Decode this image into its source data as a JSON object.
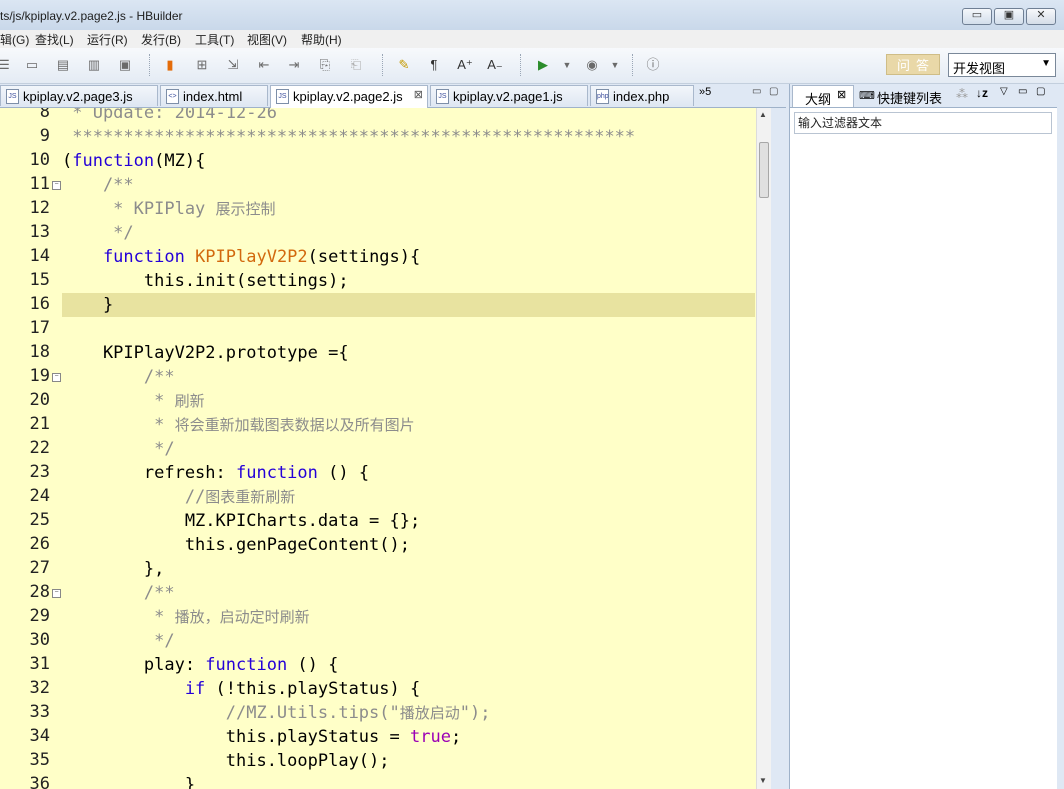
{
  "window": {
    "title": "ts/js/kpiplay.v2.page2.js  -  HBuilder",
    "buttons": {
      "minimize": "▭",
      "maximize": "▣",
      "close": "✕"
    }
  },
  "menu": [
    {
      "label": "辑(G)"
    },
    {
      "label": "查找(L)"
    },
    {
      "label": "运行(R)"
    },
    {
      "label": "发行(B)"
    },
    {
      "label": "工具(T)"
    },
    {
      "label": "视图(V)"
    },
    {
      "label": "帮助(H)"
    }
  ],
  "toolbar": {
    "qa_label": "问答",
    "view_select": "开发视图",
    "icons": [
      "list-icon",
      "layout-icon",
      "layout2-icon",
      "layout3-icon",
      "save-icon",
      "bookmark-icon",
      "new-file-icon",
      "export-icon",
      "prev-icon",
      "next-icon",
      "back-icon",
      "forward-icon",
      "highlighter-icon",
      "pilcrow-icon",
      "font-increase-icon",
      "font-decrease-icon",
      "run-icon",
      "dropdown-icon",
      "browser-icon",
      "dropdown2-icon",
      "info-icon"
    ]
  },
  "tabs": [
    {
      "label": "kpiplay.v2.page3.js",
      "active": false
    },
    {
      "label": "index.html",
      "active": false
    },
    {
      "label": "kpiplay.v2.page2.js",
      "active": true
    },
    {
      "label": "kpiplay.v2.page1.js",
      "active": false
    },
    {
      "label": "index.php",
      "active": false
    }
  ],
  "tab_overflow": "»5",
  "right_panel": {
    "tabs": [
      {
        "label": "大纲"
      },
      {
        "label": "快捷键列表"
      }
    ],
    "filter_placeholder": "输入过滤器文本"
  },
  "editor": {
    "highlight_line": 16,
    "lines": [
      {
        "n": "8",
        "t": [
          {
            "c": "c-comment",
            "s": " * Update: 2014-12-26"
          }
        ]
      },
      {
        "n": "9",
        "t": [
          {
            "c": "c-comment",
            "s": " *******************************************************"
          }
        ]
      },
      {
        "n": "10",
        "t": [
          {
            "c": "",
            "s": "("
          },
          {
            "c": "c-kw",
            "s": "function"
          },
          {
            "c": "",
            "s": "(MZ){"
          }
        ]
      },
      {
        "n": "11",
        "fold": true,
        "t": [
          {
            "c": "c-comment",
            "s": "    /**"
          }
        ]
      },
      {
        "n": "12",
        "t": [
          {
            "c": "c-comment",
            "s": "     * KPIPlay "
          },
          {
            "c": "c-comment cn",
            "s": "展示控制"
          }
        ]
      },
      {
        "n": "13",
        "t": [
          {
            "c": "c-comment",
            "s": "     */"
          }
        ]
      },
      {
        "n": "14",
        "t": [
          {
            "c": "c-kw",
            "s": "    function "
          },
          {
            "c": "c-fn",
            "s": "KPIPlayV2P2"
          },
          {
            "c": "",
            "s": "(settings){"
          }
        ]
      },
      {
        "n": "15",
        "t": [
          {
            "c": "",
            "s": "        this.init(settings);"
          }
        ]
      },
      {
        "n": "16",
        "t": [
          {
            "c": "",
            "s": "    }"
          }
        ]
      },
      {
        "n": "17",
        "t": []
      },
      {
        "n": "18",
        "t": [
          {
            "c": "",
            "s": "    KPIPlayV2P2.prototype ={"
          }
        ]
      },
      {
        "n": "19",
        "fold": true,
        "t": [
          {
            "c": "c-comment",
            "s": "        /**"
          }
        ]
      },
      {
        "n": "20",
        "t": [
          {
            "c": "c-comment",
            "s": "         * "
          },
          {
            "c": "c-comment cn",
            "s": "刷新"
          }
        ]
      },
      {
        "n": "21",
        "t": [
          {
            "c": "c-comment",
            "s": "         * "
          },
          {
            "c": "c-comment cn",
            "s": "将会重新加载图表数据以及所有图片"
          }
        ]
      },
      {
        "n": "22",
        "t": [
          {
            "c": "c-comment",
            "s": "         */"
          }
        ]
      },
      {
        "n": "23",
        "t": [
          {
            "c": "",
            "s": "        refresh: "
          },
          {
            "c": "c-kw",
            "s": "function"
          },
          {
            "c": "",
            "s": " () {"
          }
        ]
      },
      {
        "n": "24",
        "t": [
          {
            "c": "c-comment",
            "s": "            //"
          },
          {
            "c": "c-comment cn",
            "s": "图表重新刷新"
          }
        ]
      },
      {
        "n": "25",
        "t": [
          {
            "c": "",
            "s": "            MZ.KPICharts.data = {};"
          }
        ]
      },
      {
        "n": "26",
        "t": [
          {
            "c": "",
            "s": "            this.genPageContent();"
          }
        ]
      },
      {
        "n": "27",
        "t": [
          {
            "c": "",
            "s": "        },"
          }
        ]
      },
      {
        "n": "28",
        "fold": true,
        "t": [
          {
            "c": "c-comment",
            "s": "        /**"
          }
        ]
      },
      {
        "n": "29",
        "t": [
          {
            "c": "c-comment",
            "s": "         * "
          },
          {
            "c": "c-comment cn",
            "s": "播放，启动定时刷新"
          }
        ]
      },
      {
        "n": "30",
        "t": [
          {
            "c": "c-comment",
            "s": "         */"
          }
        ]
      },
      {
        "n": "31",
        "t": [
          {
            "c": "",
            "s": "        play: "
          },
          {
            "c": "c-kw",
            "s": "function"
          },
          {
            "c": "",
            "s": " () {"
          }
        ]
      },
      {
        "n": "32",
        "t": [
          {
            "c": "c-kw",
            "s": "            if"
          },
          {
            "c": "",
            "s": " (!this.playStatus) {"
          }
        ]
      },
      {
        "n": "33",
        "t": [
          {
            "c": "c-comment",
            "s": "                //MZ.Utils.tips(\""
          },
          {
            "c": "c-comment cn",
            "s": "播放启动"
          },
          {
            "c": "c-comment",
            "s": "\");"
          }
        ]
      },
      {
        "n": "34",
        "t": [
          {
            "c": "",
            "s": "                this.playStatus = "
          },
          {
            "c": "c-true",
            "s": "true"
          },
          {
            "c": "",
            "s": ";"
          }
        ]
      },
      {
        "n": "35",
        "t": [
          {
            "c": "",
            "s": "                this.loopPlay();"
          }
        ]
      },
      {
        "n": "36",
        "t": [
          {
            "c": "",
            "s": "            }"
          }
        ]
      }
    ]
  }
}
